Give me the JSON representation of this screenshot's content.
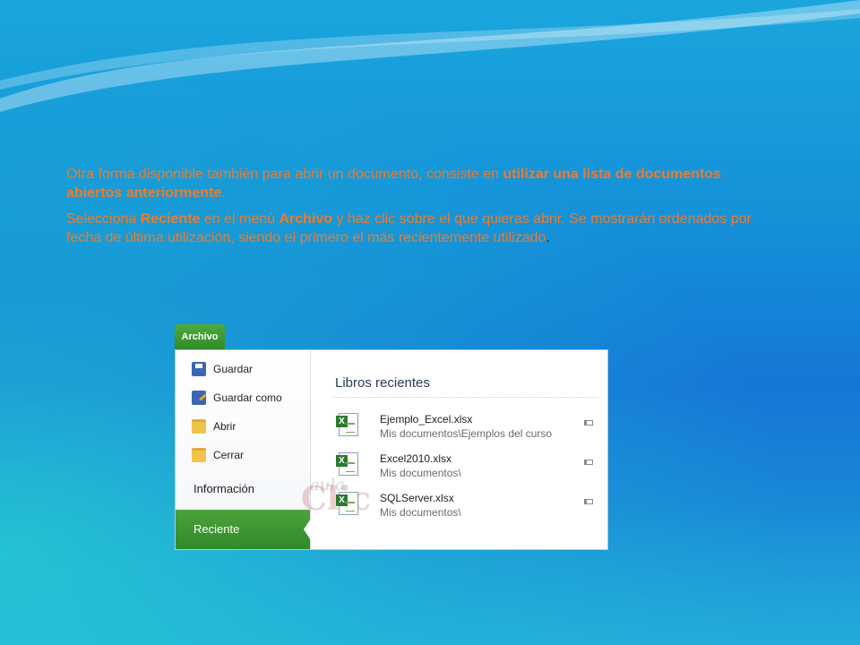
{
  "slide": {
    "paragraph1": {
      "normal": " Otra forma disponible también para abrir un documento, consiste en ",
      "bold": "utilizar una lista de documentos abiertos anteriormente",
      "end": "."
    },
    "paragraph2": {
      "t1": "Selecciona ",
      "b1": "Reciente",
      "t2": " en el menú ",
      "b2": "Archivo",
      "t3": " y haz clic sobre el que quieras abrir. Se mostrarán ordenados por fecha de última utilización, siendo el primero el más recientemente utilizado",
      "end": "."
    }
  },
  "excel": {
    "tab_label": "Archivo",
    "menu": {
      "save": "Guardar",
      "save_as": "Guardar como",
      "open": "Abrir",
      "close": "Cerrar",
      "info": "Información",
      "recent": "Reciente"
    },
    "recent_pane": {
      "title": "Libros recientes",
      "files": [
        {
          "name": "Ejemplo_Excel.xlsx",
          "path": "Mis documentos\\Ejemplos del curso"
        },
        {
          "name": "Excel2010.xlsx",
          "path": "Mis documentos\\"
        },
        {
          "name": "SQLServer.xlsx",
          "path": "Mis documentos\\"
        }
      ]
    },
    "watermark": {
      "top": "aula",
      "main": "Clic"
    }
  },
  "colors": {
    "text_orange": "#f07a2b",
    "excel_green": "#2f8a2a"
  }
}
